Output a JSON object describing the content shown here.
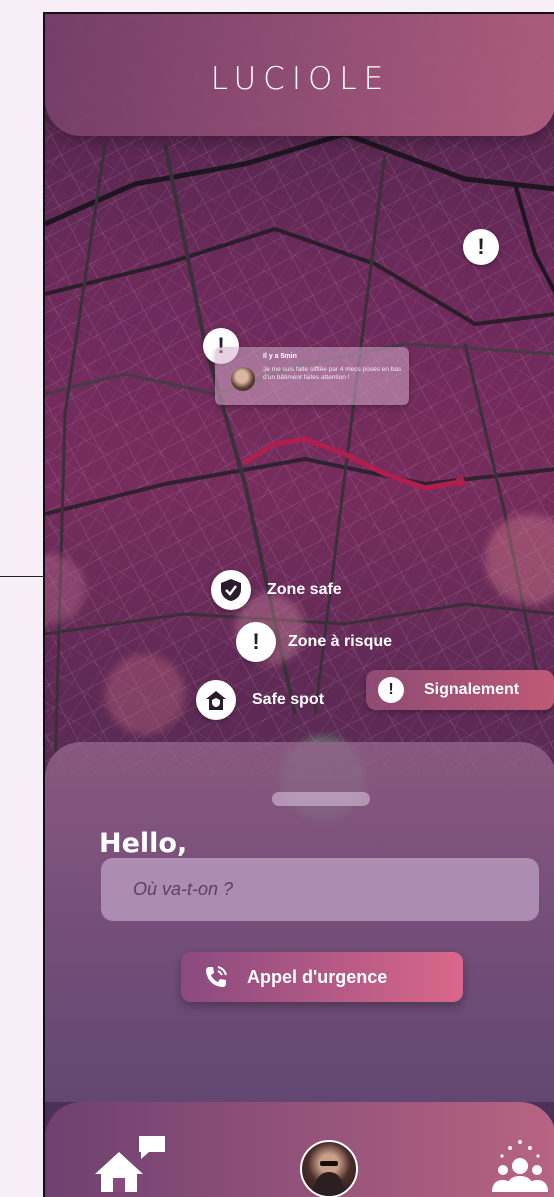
{
  "header": {
    "logo": "LUCIOLE"
  },
  "map": {
    "alert_glyph": "!",
    "report": {
      "time": "Il y a 5min",
      "text": "Je me suis faite sifflée par 4 mecs posés en bas d'un bâtiment faites attention !"
    }
  },
  "legend": {
    "zone_safe": "Zone safe",
    "zone_risk": "Zone à risque",
    "safe_spot": "Safe spot"
  },
  "signalement": {
    "label": "Signalement"
  },
  "sheet": {
    "greeting": "Hello,",
    "search_placeholder": "Où va-t-on ?",
    "emergency_label": "Appel d'urgence"
  },
  "nav": {
    "items": [
      "home-chat-icon",
      "profile-avatar",
      "community-icon"
    ]
  },
  "colors": {
    "route": "#b01e4e",
    "header_left": "#78406c",
    "header_right": "#b26080",
    "emergency_right": "#d9678a"
  }
}
